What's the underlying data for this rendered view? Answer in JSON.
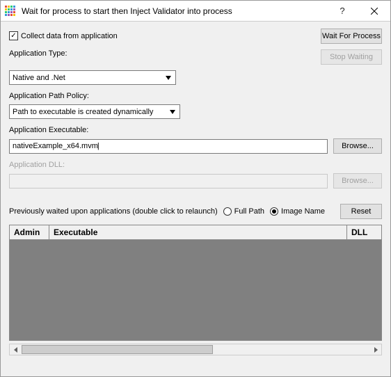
{
  "window": {
    "title": "Wait for process to start then Inject Validator into process"
  },
  "top": {
    "collect_label": "Collect data from application",
    "collect_checked": true,
    "wait_button": "Wait For Process",
    "stop_button": "Stop Waiting"
  },
  "app_type": {
    "label": "Application Type:",
    "value": "Native and .Net"
  },
  "path_policy": {
    "label": "Application Path Policy:",
    "value": "Path to executable is created dynamically"
  },
  "executable": {
    "label": "Application Executable:",
    "value": "nativeExample_x64.mvm",
    "browse": "Browse..."
  },
  "dll": {
    "label": "Application DLL:",
    "value": "",
    "browse": "Browse..."
  },
  "prev": {
    "label": "Previously waited upon applications (double click to relaunch)",
    "radio_fullpath": "Full Path",
    "radio_imagename": "Image Name",
    "selected": "imagename",
    "reset": "Reset"
  },
  "grid": {
    "cols": {
      "admin": "Admin",
      "exec": "Executable",
      "dll": "DLL"
    }
  }
}
